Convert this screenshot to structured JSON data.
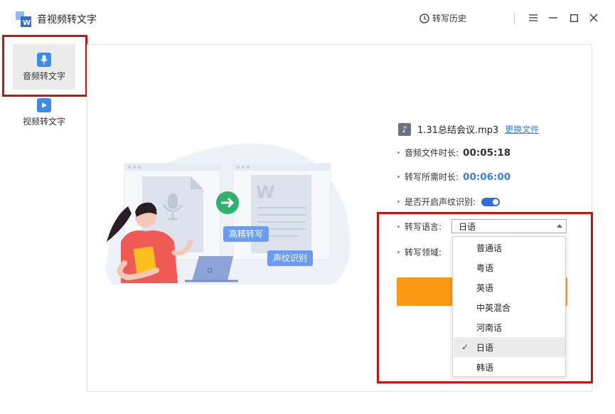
{
  "app": {
    "title": "音视频转文字",
    "history_label": "转写历史"
  },
  "sidebar": {
    "items": [
      {
        "label": "音频转文字",
        "icon": "microphone-icon",
        "active": true
      },
      {
        "label": "视频转文字",
        "icon": "video-camera-icon",
        "active": false
      }
    ]
  },
  "illustration": {
    "bubble_hd": "高精转写",
    "bubble_voiceprint": "声纹识别"
  },
  "file": {
    "name": "1.31总结会议.mp3",
    "change_label": "更换文件"
  },
  "info": {
    "duration_label": "音频文件时长:",
    "duration_value": "00:05:18",
    "needed_label": "转写所需时长:",
    "needed_value": "00:06:00",
    "voiceprint_label": "是否开启声纹识别:",
    "voiceprint_on": true,
    "language_label": "转写语言:",
    "language_value": "日语",
    "domain_label": "转写领域:"
  },
  "language_options": [
    {
      "label": "普通话",
      "selected": false
    },
    {
      "label": "粤语",
      "selected": false
    },
    {
      "label": "英语",
      "selected": false
    },
    {
      "label": "中英混合",
      "selected": false
    },
    {
      "label": "河南话",
      "selected": false
    },
    {
      "label": "日语",
      "selected": true
    },
    {
      "label": "韩语",
      "selected": false
    }
  ],
  "colors": {
    "accent": "#3a7de0",
    "start_button": "#fb9a12",
    "highlight_box": "#c0170f",
    "bubble": "#6a9cf0"
  }
}
